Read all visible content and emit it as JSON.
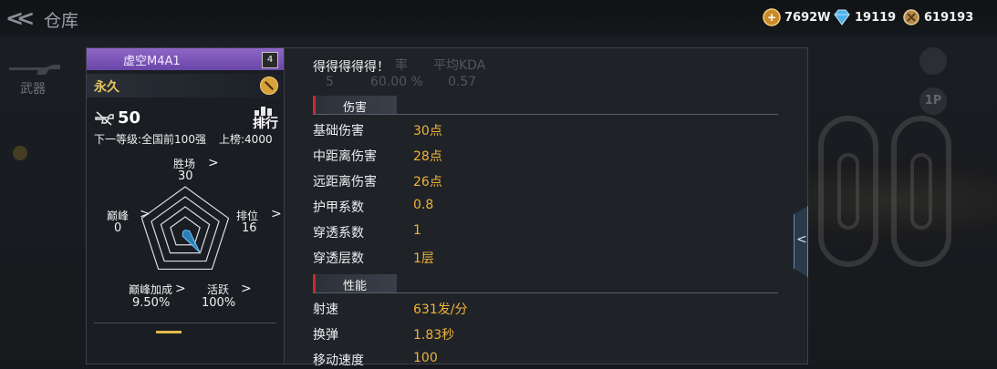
{
  "header": {
    "title": "仓库",
    "currencies": [
      {
        "name": "gold-currency",
        "value": "7692W",
        "icon": "gold-plus-icon"
      },
      {
        "name": "diamond-currency",
        "value": "19119",
        "icon": "diamond-icon"
      },
      {
        "name": "coin-currency",
        "value": "619193",
        "icon": "coin-icon"
      }
    ]
  },
  "sidebar": {
    "weapon_label": "武器"
  },
  "right_controls": {
    "perspective_label": "1P"
  },
  "weapon": {
    "name": "虚空M4A1",
    "badge": "4",
    "duration": "永久",
    "level": "50",
    "rank_label": "排行",
    "next_level": "下一等级:全国前100强",
    "board_rank": "上榜:4000",
    "stats": {
      "battles": {
        "label": "胜场",
        "value": "30"
      },
      "rank": {
        "label": "排位",
        "value": "16"
      },
      "active": {
        "label": "活跃",
        "value": "100%"
      },
      "peak_bonus": {
        "label": "巅峰加成",
        "value": "9.50%"
      },
      "peak": {
        "label": "巅峰",
        "value": "0"
      }
    },
    "radar_levels": [
      0.05,
      0.1,
      0.55,
      0.1,
      0.05
    ]
  },
  "overlay": {
    "text": "得得得得得！",
    "ghost_header": [
      "率",
      "平均KDA"
    ],
    "ghost_values": [
      "5",
      "60.00 %",
      "0.57"
    ]
  },
  "sections": [
    {
      "title": "伤害",
      "rows": [
        {
          "name": "基础伤害",
          "value": "30点"
        },
        {
          "name": "中距离伤害",
          "value": "28点"
        },
        {
          "name": "远距离伤害",
          "value": "26点"
        },
        {
          "name": "护甲系数",
          "value": "0.8"
        },
        {
          "name": "穿透系数",
          "value": "1"
        },
        {
          "name": "穿透层数",
          "value": "1层"
        }
      ]
    },
    {
      "title": "性能",
      "rows": [
        {
          "name": "射速",
          "value": "631发/分"
        },
        {
          "name": "换弹",
          "value": "1.83秒"
        },
        {
          "name": "移动速度",
          "value": "100"
        }
      ]
    }
  ]
}
